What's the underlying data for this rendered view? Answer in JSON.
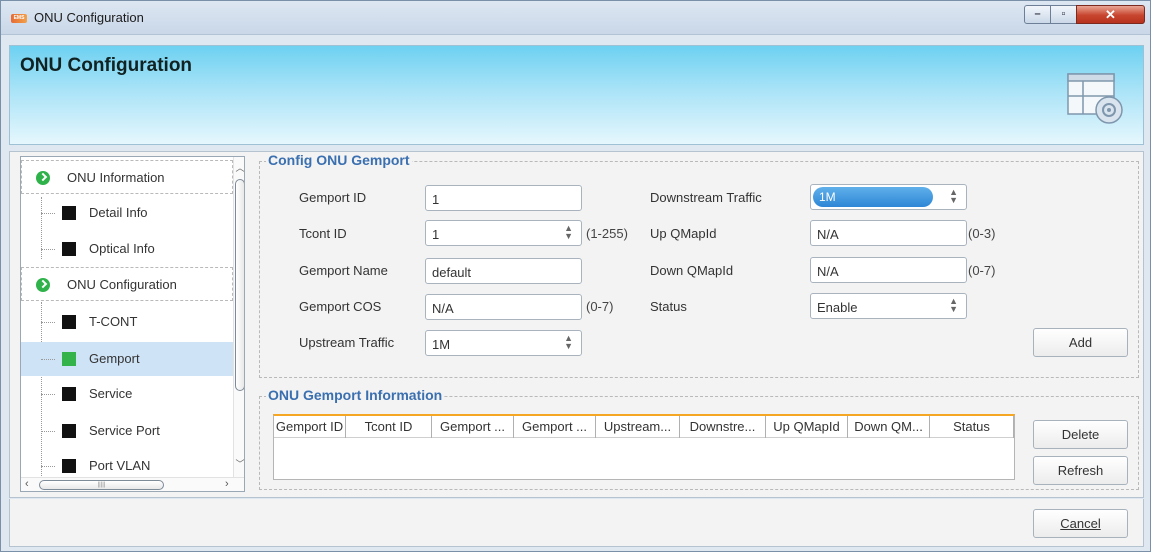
{
  "window": {
    "title": "ONU Configuration",
    "app_icon_text": "EMS",
    "controls": {
      "minimize": "–",
      "maximize": "▫",
      "close": "✕"
    }
  },
  "banner": {
    "title": "ONU Configuration",
    "icon": "config-window-icon"
  },
  "tree": {
    "items": [
      {
        "label": "ONU Information",
        "kind": "group",
        "icon": "check-circle-icon"
      },
      {
        "label": "Detail Info",
        "kind": "leaf"
      },
      {
        "label": "Optical Info",
        "kind": "leaf"
      },
      {
        "label": "ONU Configuration",
        "kind": "group",
        "icon": "check-circle-icon"
      },
      {
        "label": "T-CONT",
        "kind": "leaf"
      },
      {
        "label": "Gemport",
        "kind": "leaf",
        "selected": true
      },
      {
        "label": "Service",
        "kind": "leaf"
      },
      {
        "label": "Service Port",
        "kind": "leaf"
      },
      {
        "label": "Port VLAN",
        "kind": "leaf"
      }
    ]
  },
  "config": {
    "title": "Config ONU Gemport",
    "gemport_id": {
      "label": "Gemport ID",
      "value": "1"
    },
    "tcont_id": {
      "label": "Tcont ID",
      "value": "1",
      "range": "(1-255)"
    },
    "gemport_name": {
      "label": "Gemport Name",
      "value": "default"
    },
    "gemport_cos": {
      "label": "Gemport COS",
      "value": "N/A",
      "range": "(0-7)"
    },
    "upstream_traffic": {
      "label": "Upstream Traffic",
      "value": "1M"
    },
    "downstream_traffic": {
      "label": "Downstream Traffic",
      "value": "1M"
    },
    "up_qmapid": {
      "label": "Up QMapId",
      "value": "N/A",
      "range": "(0-3)"
    },
    "down_qmapid": {
      "label": "Down QMapId",
      "value": "N/A",
      "range": "(0-7)"
    },
    "status": {
      "label": "Status",
      "value": "Enable"
    },
    "add_label": "Add"
  },
  "info": {
    "title": "ONU Gemport Information",
    "columns": [
      "Gemport ID",
      "Tcont ID",
      "Gemport ...",
      "Gemport ...",
      "Upstream...",
      "Downstre...",
      "Up QMapId",
      "Down QM...",
      "Status"
    ],
    "rows": [],
    "delete_label": "Delete",
    "refresh_label": "Refresh"
  },
  "footer": {
    "cancel_label": "Cancel"
  },
  "colors": {
    "accent": "#3a6fb0",
    "table_header_line": "#f5a623",
    "selected_item": "#cfe3f7",
    "group_check": "#2fb24a"
  }
}
